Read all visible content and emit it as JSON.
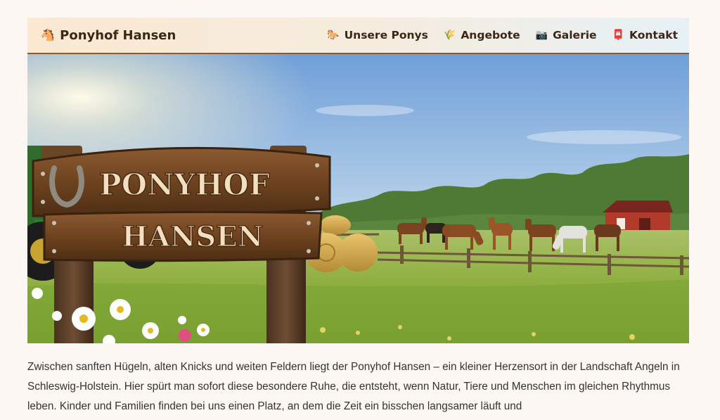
{
  "brand": {
    "icon": "horse-icon",
    "name": "Ponyhof Hansen"
  },
  "nav": [
    {
      "icon": "pony-icon",
      "label": "Unsere Ponys"
    },
    {
      "icon": "wheat-icon",
      "label": "Angebote"
    },
    {
      "icon": "camera-icon",
      "label": "Galerie"
    },
    {
      "icon": "mailbox-icon",
      "label": "Kontakt"
    }
  ],
  "hero": {
    "sign_line1": "PONYHOF",
    "sign_line2": "HANSEN"
  },
  "intro": "Zwischen sanften Hügeln, alten Knicks und weiten Feldern liegt der Ponyhof Hansen – ein kleiner Herzensort in der Landschaft Angeln in Schleswig-Holstein. Hier spürt man sofort diese besondere Ruhe, die entsteht, wenn Natur, Tiere und Menschen im gleichen Rhythmus leben. Kinder und Familien finden bei uns einen Platz, an dem die Zeit ein bisschen langsamer läuft und",
  "colors": {
    "header_border": "#8a5a35",
    "text": "#3b2718",
    "background": "#fcf7f2"
  }
}
